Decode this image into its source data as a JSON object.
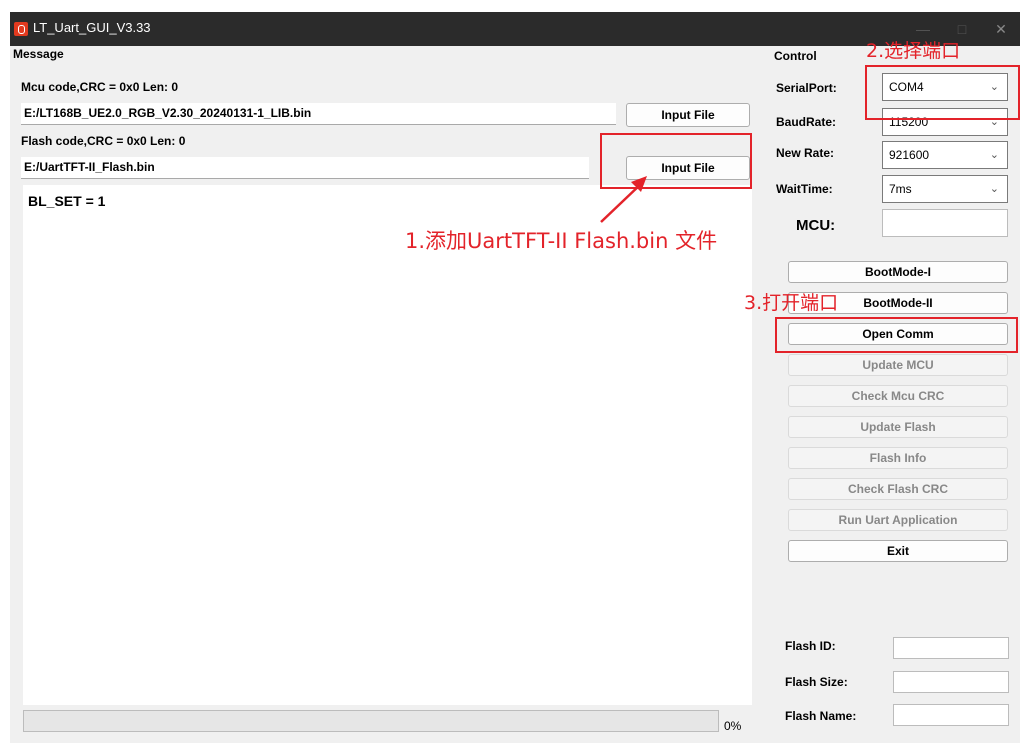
{
  "window": {
    "title": "LT_Uart_GUI_V3.33"
  },
  "message": {
    "section_label": "Message",
    "mcu_info": "Mcu code,CRC = 0x0  Len: 0",
    "mcu_path": "E:/LT168B_UE2.0_RGB_V2.30_20240131-1_LIB.bin",
    "mcu_input_button": "Input File",
    "flash_info": "Flash code,CRC = 0x0  Len: 0",
    "flash_path": "E:/UartTFT-II_Flash.bin",
    "flash_input_button": "Input File",
    "log_text": "BL_SET = 1",
    "progress": {
      "percent": 0,
      "label": "0%"
    }
  },
  "control": {
    "section_label": "Control",
    "serial_port": {
      "label": "SerialPort:",
      "value": "COM4"
    },
    "baud_rate": {
      "label": "BaudRate:",
      "value": "115200"
    },
    "new_rate": {
      "label": "New Rate:",
      "value": "921600"
    },
    "wait_time": {
      "label": "WaitTime:",
      "value": "7ms"
    },
    "mcu": {
      "label": "MCU:",
      "value": ""
    },
    "buttons": {
      "bootmode_1": "BootMode-I",
      "bootmode_2": "BootMode-II",
      "open_comm": "Open Comm",
      "update_mcu": "Update MCU",
      "check_mcu_crc": "Check Mcu CRC",
      "update_flash": "Update Flash",
      "flash_info": "Flash Info",
      "check_flash_crc": "Check Flash CRC",
      "run_uart_app": "Run Uart Application",
      "exit": "Exit"
    },
    "flash_id": {
      "label": "Flash ID:",
      "value": ""
    },
    "flash_size": {
      "label": "Flash Size:",
      "value": ""
    },
    "flash_name": {
      "label": "Flash Name:",
      "value": ""
    }
  },
  "annotations": {
    "step1": "1.添加UartTFT-II Flash.bin 文件",
    "step2": "2.选择端口",
    "step3": "3.打开端口"
  },
  "colors": {
    "annotation": "#e3232a",
    "titlebar": "#2b2b2b",
    "window_bg": "#f0f0f0"
  },
  "icons": {
    "app": "app-logo-icon",
    "minimize": "minimize-icon",
    "maximize": "maximize-icon",
    "close": "close-icon",
    "dropdown": "chevron-down-icon"
  }
}
